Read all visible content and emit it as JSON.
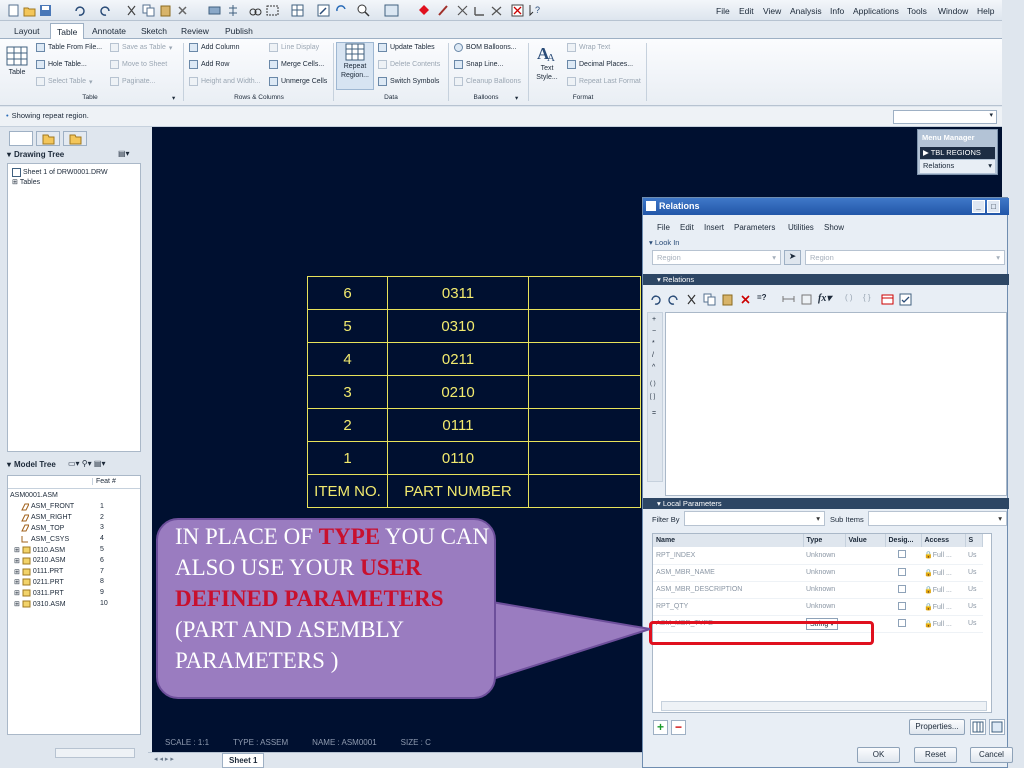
{
  "menu": [
    "File",
    "Edit",
    "View",
    "Analysis",
    "Info",
    "Applications",
    "Tools",
    "Window",
    "Help"
  ],
  "ribbon_tabs": [
    "Layout",
    "Table",
    "Annotate",
    "Sketch",
    "Review",
    "Publish"
  ],
  "ribbon": {
    "table_btn": "Table",
    "table_from_file": "Table From File...",
    "hole_table": "Hole Table...",
    "select_table": "Select Table",
    "save_as_table": "Save as Table",
    "move_to_sheet": "Move to Sheet",
    "paginate": "Paginate...",
    "add_column": "Add Column",
    "add_row": "Add Row",
    "height_width": "Height and Width...",
    "line_display": "Line Display",
    "merge_cells": "Merge Cells...",
    "unmerge_cells": "Unmerge Cells",
    "repeat_region": "Repeat Region...",
    "update_tables": "Update Tables",
    "delete_contents": "Delete Contents",
    "switch_symbols": "Switch Symbols",
    "bom_balloons": "BOM Balloons...",
    "snap_line": "Snap Line...",
    "cleanup_balloons": "Cleanup Balloons",
    "text_style": "Text Style...",
    "wrap_text": "Wrap Text",
    "decimal_places": "Decimal Places...",
    "repeat_last_format": "Repeat Last Format",
    "groups": [
      "Table",
      "Rows & Columns",
      "Data",
      "Balloons",
      "Format"
    ]
  },
  "status_message": "Showing repeat region.",
  "drawing_tree": {
    "title": "Drawing Tree",
    "items": [
      "Sheet 1 of DRW0001.DRW",
      "Tables"
    ]
  },
  "model_tree": {
    "title": "Model Tree",
    "col_header": "Feat #",
    "items": [
      {
        "name": "ASM0001.ASM",
        "num": ""
      },
      {
        "name": "ASM_FRONT",
        "num": "1"
      },
      {
        "name": "ASM_RIGHT",
        "num": "2"
      },
      {
        "name": "ASM_TOP",
        "num": "3"
      },
      {
        "name": "ASM_CSYS",
        "num": "4"
      },
      {
        "name": "0110.ASM",
        "num": "5"
      },
      {
        "name": "0210.ASM",
        "num": "6"
      },
      {
        "name": "0111.PRT",
        "num": "7"
      },
      {
        "name": "0211.PRT",
        "num": "8"
      },
      {
        "name": "0311.PRT",
        "num": "9"
      },
      {
        "name": "0310.ASM",
        "num": "10"
      }
    ]
  },
  "drawing_table": {
    "rows": [
      [
        "6",
        "0311"
      ],
      [
        "5",
        "0310"
      ],
      [
        "4",
        "0211"
      ],
      [
        "3",
        "0210"
      ],
      [
        "2",
        "0111"
      ],
      [
        "1",
        "0110"
      ]
    ],
    "header": [
      "ITEM NO.",
      "PART NUMBER"
    ]
  },
  "scale_text": [
    "SCALE : 1:1",
    "TYPE : ASSEM",
    "NAME : ASM0001",
    "SIZE : C"
  ],
  "sheet_tab": "Sheet 1",
  "menu_manager": {
    "title": "Menu Manager",
    "active": "TBL REGIONS",
    "item": "Relations"
  },
  "relations_dialog": {
    "title": "Relations",
    "menu": [
      "File",
      "Edit",
      "Insert",
      "Parameters",
      "Utilities",
      "Show"
    ],
    "look_in": "Look In",
    "look_in_value": "Region",
    "look_in_field": "Region",
    "relations_label": "Relations",
    "local_params_label": "Local Parameters",
    "filter_by": "Filter By",
    "sub_items": "Sub Items",
    "operators": [
      "+",
      "−",
      "*",
      "/",
      "^",
      "( )",
      "[ ]",
      "="
    ],
    "columns": [
      "Name",
      "Type",
      "Value",
      "Desig...",
      "Access",
      "S"
    ],
    "params": [
      {
        "name": "RPT_INDEX",
        "type": "Unknown",
        "access": "Full ...",
        "s": "Us"
      },
      {
        "name": "ASM_MBR_NAME",
        "type": "Unknown",
        "access": "Full ...",
        "s": "Us"
      },
      {
        "name": "ASM_MBR_DESCRIPTION",
        "type": "Unknown",
        "access": "Full ...",
        "s": "Us"
      },
      {
        "name": "RPT_QTY",
        "type": "Unknown",
        "access": "Full ...",
        "s": "Us"
      },
      {
        "name": "ASM_MBR_TYPE",
        "type": "String",
        "access": "Full ...",
        "s": "Us"
      }
    ],
    "properties_btn": "Properties...",
    "ok_btn": "OK",
    "reset_btn": "Reset",
    "cancel_btn": "Cancel"
  },
  "callout": {
    "t1": "IN PLACE OF ",
    "t2": "TYPE",
    "t3": " YOU CAN ALSO USE YOUR ",
    "t4": "USER DEFINED PARAMETERS",
    "t5": " (PART AND ASEMBLY PARAMETERS )"
  },
  "colors": {
    "canvas": "#001030",
    "table_line": "#e8e25a",
    "callout": "#9a7cc0",
    "highlight": "#e0101e",
    "accent": "#c8102e"
  }
}
